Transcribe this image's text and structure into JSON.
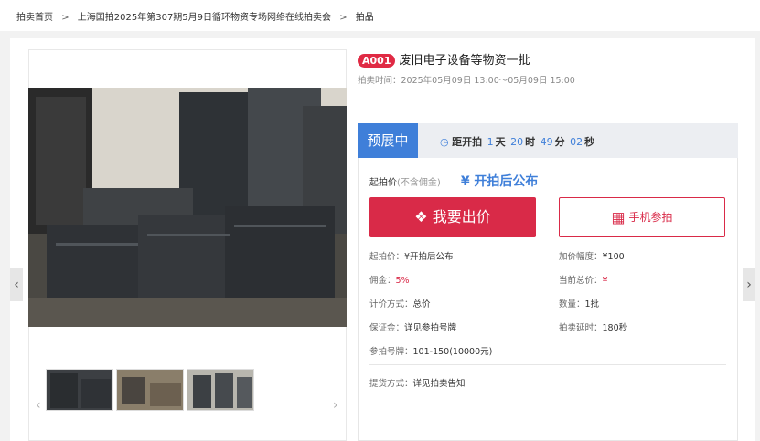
{
  "breadcrumb": {
    "home": "拍卖首页",
    "separator": ">",
    "auction": "上海国拍2025年第307期5月9日循环物资专场网络在线拍卖会",
    "current": "拍品"
  },
  "lot": {
    "badge": "A001",
    "title": "废旧电子设备等物资一批",
    "time": "拍卖时间：2025年05月09日 13:00～05月09日 15:00"
  },
  "status": {
    "label": "预展中",
    "countdown_label": "距开拍",
    "days": "1",
    "days_unit": "天",
    "hours": "20",
    "hours_unit": "时",
    "minutes": "49",
    "minutes_unit": "分",
    "seconds": "02",
    "seconds_unit": "秒"
  },
  "price": {
    "label": "起拍价",
    "sublabel": "(不含佣金)",
    "value": "¥ 开拍后公布"
  },
  "buttons": {
    "bid": "我要出价",
    "mobile": "手机参拍"
  },
  "details": {
    "start_price": {
      "k": "起拍价：",
      "v": "¥开拍后公布"
    },
    "increment": {
      "k": "加价幅度：",
      "v": "¥100"
    },
    "commission": {
      "k": "佣金：",
      "v": "5%"
    },
    "current_total": {
      "k": "当前总价：",
      "v": "¥"
    },
    "pricing_method": {
      "k": "计价方式：",
      "v": "总价"
    },
    "quantity": {
      "k": "数量：",
      "v": "1批"
    },
    "deposit": {
      "k": "保证金：",
      "v": "详见参拍号牌"
    },
    "delay": {
      "k": "拍卖延时：",
      "v": "180秒"
    },
    "paddle": {
      "k": "参拍号牌：",
      "v": "101-150(10000元)"
    },
    "pickup": {
      "k": "提货方式：",
      "v": "详见拍卖告知"
    }
  },
  "colors": {
    "accent_blue": "#3f7fd9",
    "accent_red": "#d92a48"
  },
  "icons": {
    "bid": "hammer-icon",
    "mobile": "qr-code-icon",
    "clock": "clock-icon"
  }
}
